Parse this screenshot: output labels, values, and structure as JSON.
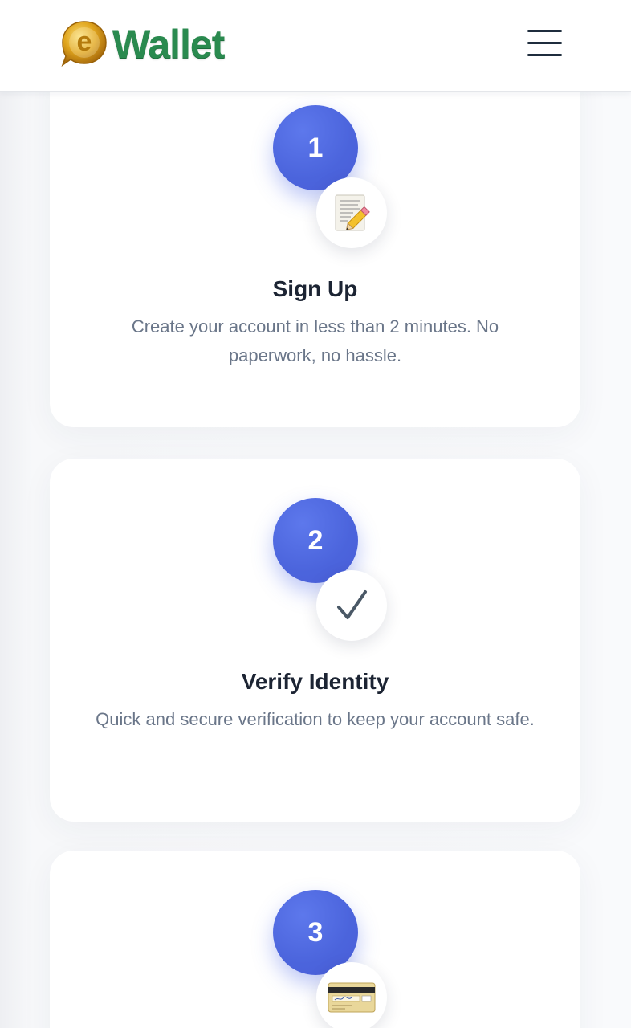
{
  "header": {
    "logo_letter": "e",
    "logo_text": "Wallet",
    "menu_icon": "hamburger-menu-icon"
  },
  "steps": [
    {
      "number": "1",
      "icon": "memo-pencil-icon",
      "title": "Sign Up",
      "description": "Create your account in less than 2 minutes. No paperwork, no hassle."
    },
    {
      "number": "2",
      "icon": "check-mark-icon",
      "title": "Verify Identity",
      "description": "Quick and secure verification to keep your account safe."
    },
    {
      "number": "3",
      "icon": "credit-card-icon",
      "title": "",
      "description": ""
    }
  ],
  "colors": {
    "accent_blue": "#4b64dc",
    "logo_green": "#2a8a4f",
    "logo_gold": "#d9a21b",
    "title_text": "#1c2433",
    "body_text": "#6a7689"
  }
}
